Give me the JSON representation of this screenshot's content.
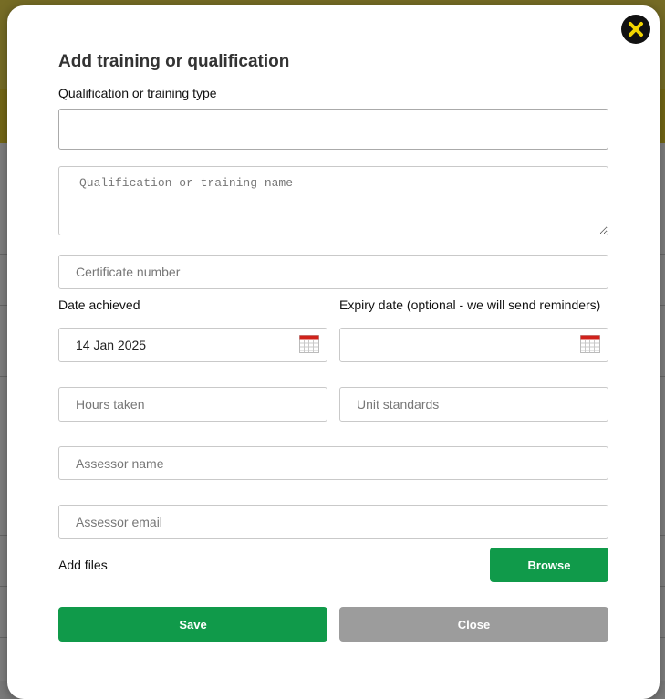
{
  "modal": {
    "title": "Add training or qualification",
    "qualification_type_label": "Qualification or training type",
    "qualification_type_value": "",
    "qualification_name_placeholder": "Qualification or training name",
    "certificate_placeholder": "Certificate number",
    "date_achieved_label": "Date achieved",
    "date_achieved_value": "14 Jan 2025",
    "expiry_label": "Expiry date (optional - we will send reminders)",
    "expiry_value": "",
    "hours_placeholder": "Hours taken",
    "unit_standards_placeholder": "Unit standards",
    "assessor_name_placeholder": "Assessor name",
    "assessor_email_placeholder": "Assessor email",
    "add_files_label": "Add files",
    "browse_label": "Browse",
    "save_label": "Save",
    "close_label": "Close"
  },
  "icons": {
    "close": "close-icon",
    "calendar": "calendar-icon"
  },
  "colors": {
    "header_yellow": "#ecd94a",
    "primary_green": "#109a4a",
    "disabled_grey": "#9c9c9c",
    "close_icon_yellow": "#f2d500"
  }
}
